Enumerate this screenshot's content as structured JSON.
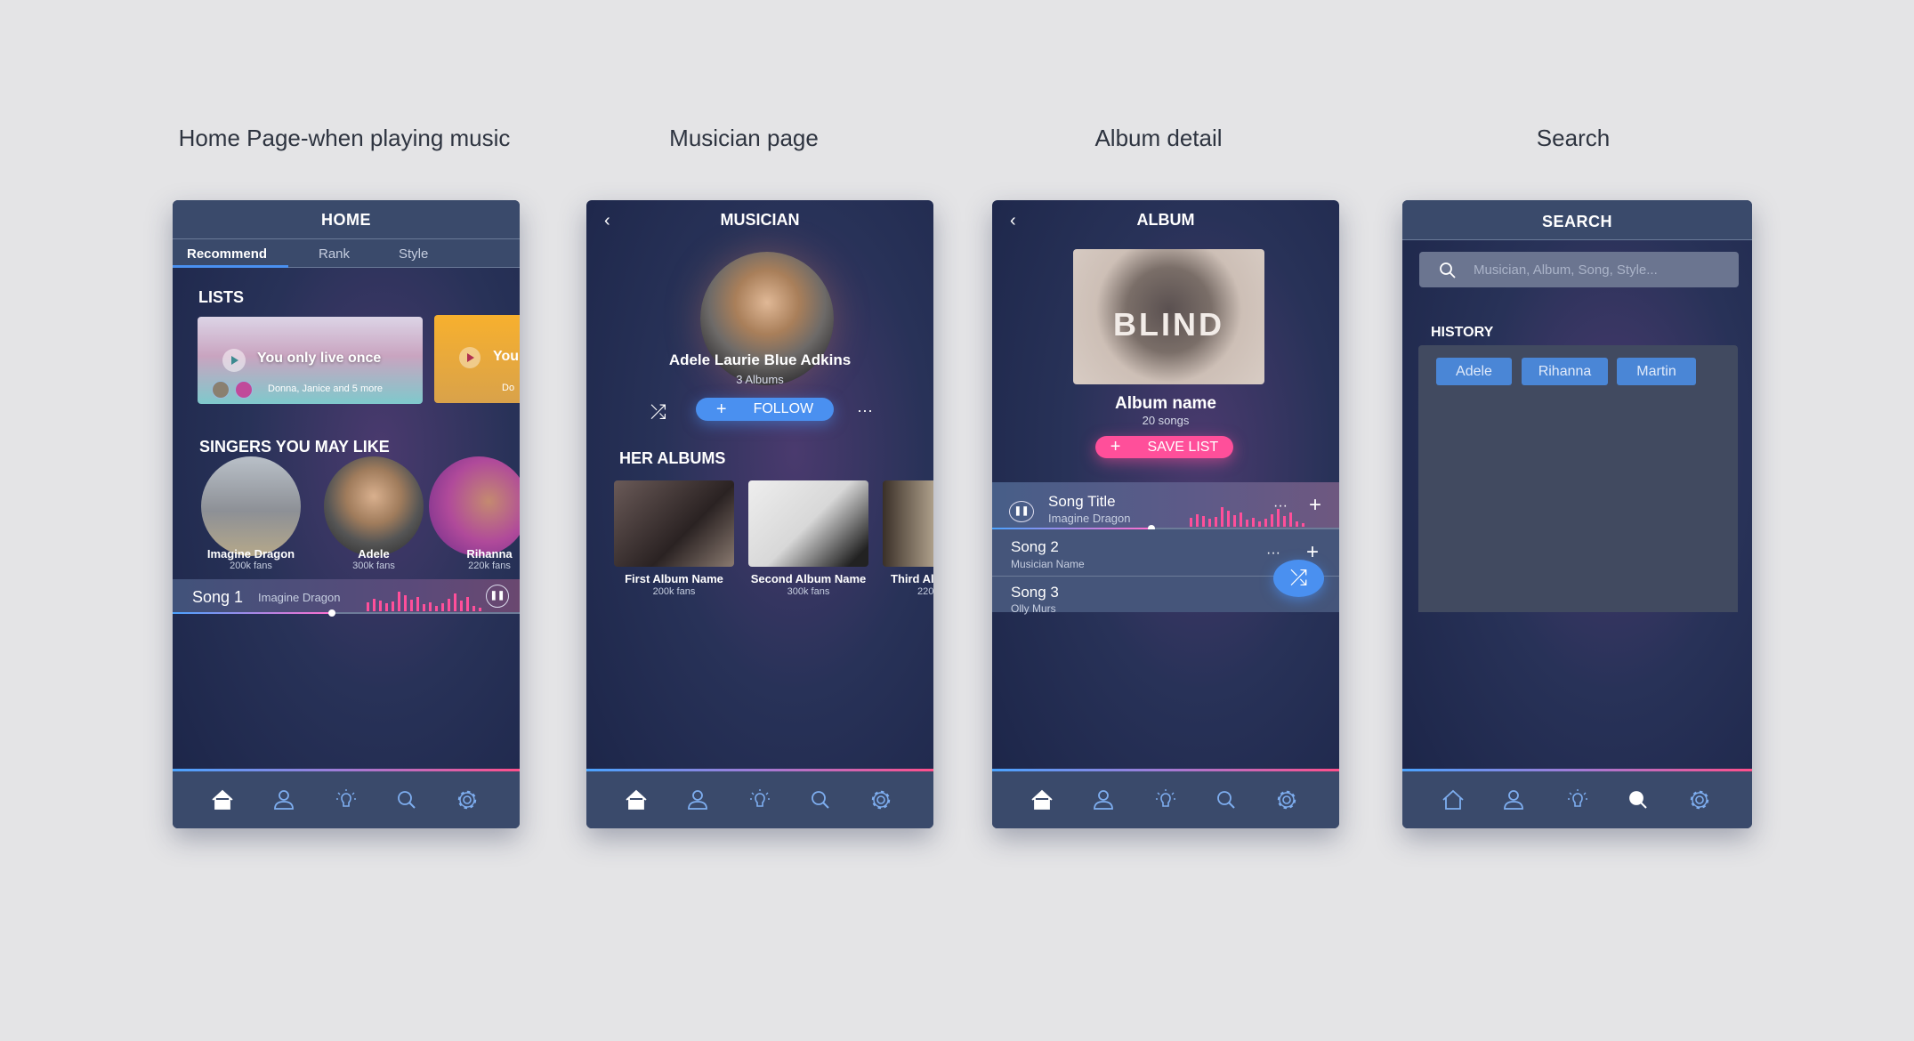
{
  "screen_titles": [
    "Home Page-when playing music",
    "Musician page",
    "Album detail",
    "Search"
  ],
  "home": {
    "header": "HOME",
    "tabs": [
      "Recommend",
      "Rank",
      "Style"
    ],
    "active_tab": "Recommend",
    "lists_heading": "LISTS",
    "lists": [
      {
        "title": "You only live once",
        "subtitle": "Donna, Janice and 5 more"
      },
      {
        "title": "You",
        "subtitle": "Do"
      }
    ],
    "singers_heading": "SINGERS YOU MAY LIKE",
    "singers": [
      {
        "name": "Imagine Dragon",
        "fans": "200k fans"
      },
      {
        "name": "Adele",
        "fans": "300k fans"
      },
      {
        "name": "Rihanna",
        "fans": "220k fans"
      }
    ],
    "player": {
      "song": "Song 1",
      "artist": "Imagine Dragon",
      "progress": 0.46
    }
  },
  "musician": {
    "header": "MUSICIAN",
    "name": "Adele  Laurie Blue Adkins",
    "albums_count": "3 Albums",
    "follow_label": "FOLLOW",
    "albums_heading": "HER ALBUMS",
    "albums": [
      {
        "name": "First Album Name",
        "fans": "200k fans"
      },
      {
        "name": "Second Album Name",
        "fans": "300k fans"
      },
      {
        "name": "Third Al",
        "fans": "220"
      }
    ]
  },
  "album": {
    "header": "ALBUM",
    "cover_text": "BLIND",
    "name": "Album name",
    "song_count": "20 songs",
    "save_label": "SAVE LIST",
    "songs": [
      {
        "title": "Song Title",
        "artist": "Imagine Dragon"
      },
      {
        "title": "Song 2",
        "artist": "Musician Name"
      },
      {
        "title": "Song 3",
        "artist": "Olly Murs"
      }
    ],
    "progress": 0.46
  },
  "search": {
    "header": "SEARCH",
    "placeholder": "Musician, Album, Song, Style...",
    "history_heading": "HISTORY",
    "history": [
      "Adele",
      "Rihanna",
      "Martin"
    ]
  },
  "nav_items": [
    "home-icon",
    "profile-icon",
    "lightbulb-icon",
    "search-icon",
    "settings-icon"
  ],
  "colors": {
    "accent_blue": "#4a90f0",
    "accent_pink": "#ff4f8b",
    "header": "#3a4a6b"
  }
}
